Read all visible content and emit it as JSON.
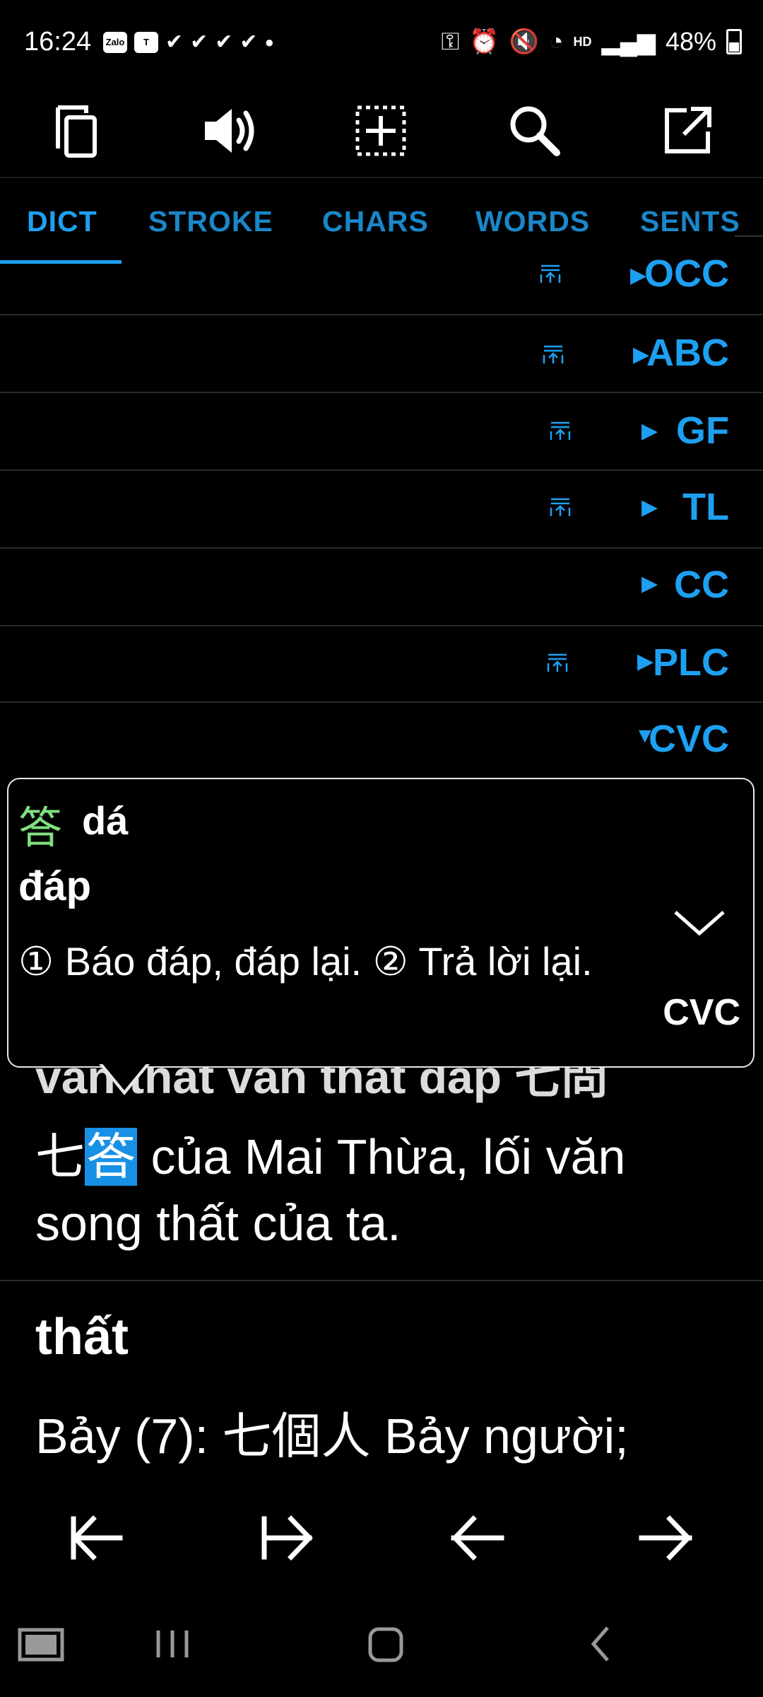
{
  "status_bar": {
    "time": "16:24",
    "left_icons": [
      "zalo-icon",
      "teams-icon",
      "check-icon",
      "check-icon",
      "check-icon",
      "check-icon",
      "dot-icon"
    ],
    "zalo_label": "Zalo",
    "teams_label": "T",
    "battery": "48%",
    "network_label": "HD"
  },
  "toolbar": {
    "icons": [
      "copy-icon",
      "speaker-icon",
      "add-grid-icon",
      "search-icon",
      "open-external-icon"
    ]
  },
  "tabs": [
    {
      "label": "DICT",
      "active": true
    },
    {
      "label": "STROKE",
      "active": false
    },
    {
      "label": "CHARS",
      "active": false
    },
    {
      "label": "WORDS",
      "active": false
    },
    {
      "label": "SENTS",
      "active": false
    }
  ],
  "dictionaries": [
    {
      "label": "OCC",
      "arrow": "▶",
      "pinned": true
    },
    {
      "label": "ABC",
      "arrow": "▶",
      "pinned": true
    },
    {
      "label": "GF",
      "arrow": "▶",
      "pinned": true
    },
    {
      "label": "TL",
      "arrow": "▶",
      "pinned": true
    },
    {
      "label": "CC",
      "arrow": "▶",
      "pinned": false
    },
    {
      "label": "PLC",
      "arrow": "▶",
      "pinned": true
    },
    {
      "label": "CVC",
      "arrow": "▼",
      "pinned": false
    }
  ],
  "popup": {
    "character": "答",
    "pinyin": "dá",
    "vietnamese": "đáp",
    "definition": "① Báo đáp, đáp lại. ② Trả lời lại.",
    "source": "CVC"
  },
  "content": {
    "partial_line": "văn thất văn thất đáp 七問",
    "line1_prefix": "七",
    "line1_highlight": "答",
    "line1_suffix": " của Mai Thừa, lối văn",
    "line2": "song thất của ta.",
    "headword": "thất",
    "definition_prefix": "Bảy (7): ",
    "definition_cjk": "七個人",
    "definition_suffix": " Bảy người;"
  },
  "navigation": {
    "buttons": [
      "first-icon",
      "last-icon",
      "previous-icon",
      "next-icon"
    ]
  }
}
